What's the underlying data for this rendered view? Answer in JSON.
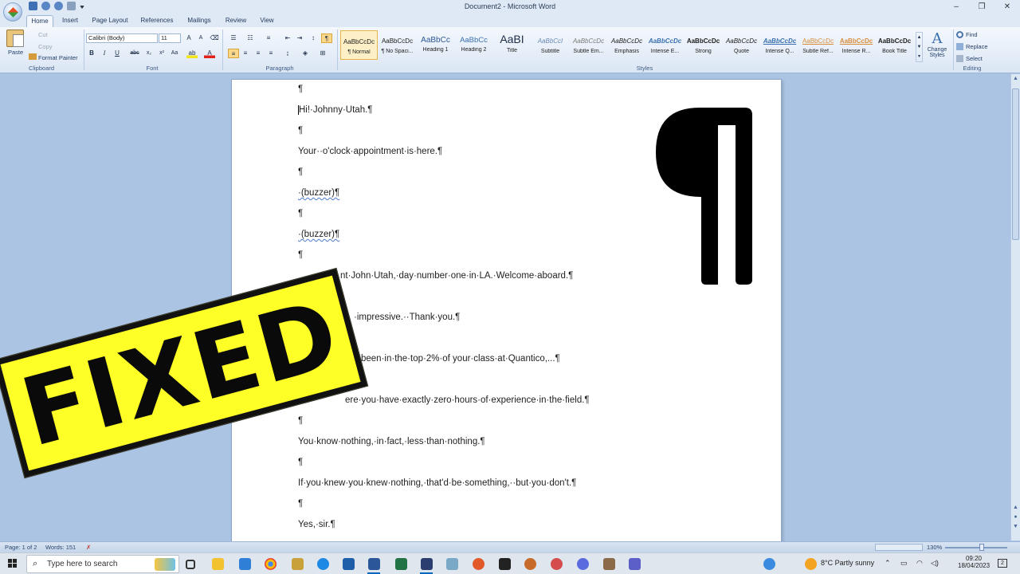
{
  "window": {
    "title": "Document2 - Microsoft Word",
    "controls": [
      "–",
      "❐",
      "✕"
    ]
  },
  "tabs": [
    "Home",
    "Insert",
    "Page Layout",
    "References",
    "Mailings",
    "Review",
    "View"
  ],
  "ribbon": {
    "clipboard": {
      "paste": "Paste",
      "cut": "Cut",
      "copy": "Copy",
      "format_painter": "Format Painter",
      "label": "Clipboard"
    },
    "font": {
      "name": "Calibri (Body)",
      "size": "11",
      "label": "Font"
    },
    "paragraph": {
      "label": "Paragraph"
    },
    "styles": {
      "label": "Styles",
      "items": [
        {
          "preview": "AaBbCcDc",
          "name": "¶ Normal"
        },
        {
          "preview": "AaBbCcDc",
          "name": "¶ No Spaci..."
        },
        {
          "preview": "AaBbCc",
          "name": "Heading 1"
        },
        {
          "preview": "AaBbCc",
          "name": "Heading 2"
        },
        {
          "preview": "AaBI",
          "name": "Title"
        },
        {
          "preview": "AaBbCcI",
          "name": "Subtitle"
        },
        {
          "preview": "AaBbCcDc",
          "name": "Subtle Em..."
        },
        {
          "preview": "AaBbCcDc",
          "name": "Emphasis"
        },
        {
          "preview": "AaBbCcDc",
          "name": "Intense E..."
        },
        {
          "preview": "AaBbCcDc",
          "name": "Strong"
        },
        {
          "preview": "AaBbCcDc",
          "name": "Quote"
        },
        {
          "preview": "AaBbCcDc",
          "name": "Intense Q..."
        },
        {
          "preview": "AaBbCcDc",
          "name": "Subtle Ref..."
        },
        {
          "preview": "AaBbCcDc",
          "name": "Intense R..."
        },
        {
          "preview": "AaBbCcDc",
          "name": "Book Title"
        }
      ],
      "change_styles": "Change Styles"
    },
    "editing": {
      "find": "Find",
      "replace": "Replace",
      "select": "Select",
      "label": "Editing"
    }
  },
  "document": {
    "lines": [
      "¶",
      "Hi!·Johnny·Utah.¶",
      "¶",
      "Your··o'clock·appointment·is·here.¶",
      "¶",
      "·(buzzer)¶",
      "¶",
      "·(buzzer)¶",
      "¶",
      "nt·John·Utah,·day·number·one·in·LA.·Welcome·aboard.¶",
      "",
      "·impressive.··Thank·you.¶",
      "",
      "been·in·the·top·2%·of your·class·at·Quantico,...¶",
      "",
      "ere·you·have·exactly·zero·hours·of·experience·in·the·field.¶",
      "¶",
      "You·know·nothing,·in·fact,·less·than·nothing.¶",
      "¶",
      "If·you·knew·you·knew·nothing,·that'd·be·something,··but·you·don't.¶",
      "¶",
      "Yes,·sir.¶"
    ]
  },
  "stamp": {
    "text": "FIXED"
  },
  "statusbar": {
    "page": "Page: 1 of 2",
    "words": "Words: 151",
    "zoom": "130%"
  },
  "taskbar": {
    "search_placeholder": "Type here to search",
    "weather": "8°C  Partly sunny",
    "time": "09:20",
    "date": "18/04/2023",
    "notifications": "2"
  }
}
